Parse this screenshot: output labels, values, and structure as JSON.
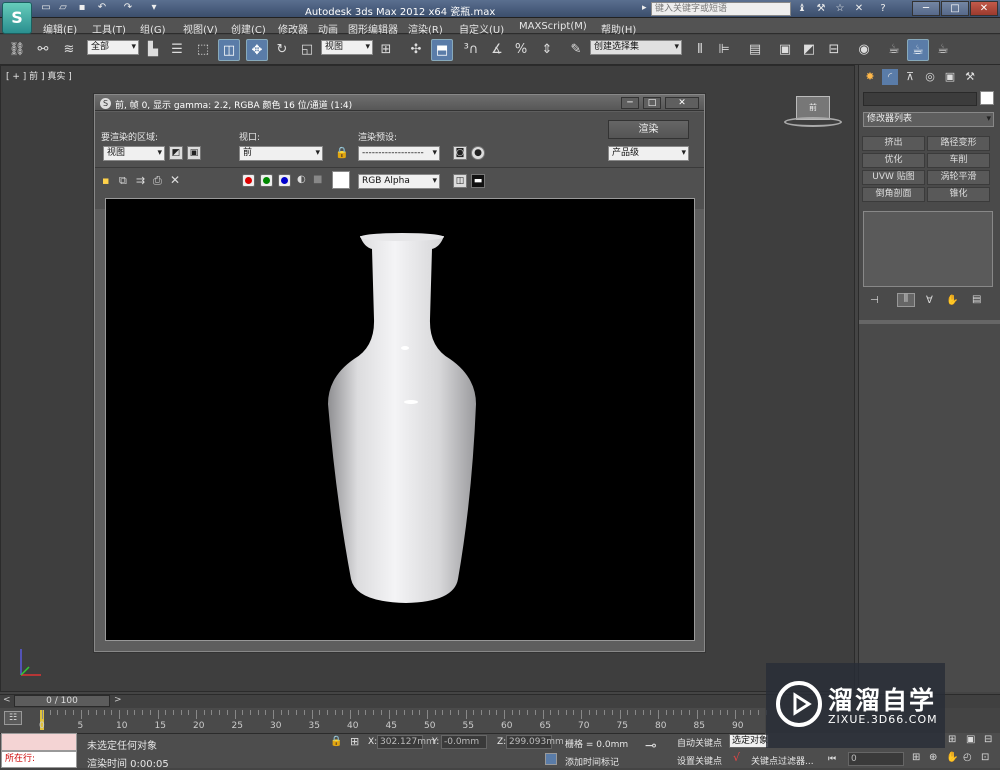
{
  "titlebar": {
    "logo": "S",
    "title": "Autodesk 3ds Max  2012 x64      瓷瓶.max",
    "search_placeholder": "键入关键字或短语",
    "min": "─",
    "max": "□",
    "close": "✕"
  },
  "menu": [
    "编辑(E)",
    "工具(T)",
    "组(G)",
    "视图(V)",
    "创建(C)",
    "修改器",
    "动画",
    "图形编辑器",
    "渲染(R)",
    "自定义(U)",
    "MAXScript(M)",
    "帮助(H)"
  ],
  "toolbar": {
    "selection_filter": "全部",
    "ref_coord": "视图",
    "named_selection": "创建选择集"
  },
  "viewport": {
    "label": "[ + ] 前 ] 真实 ]"
  },
  "render_frame": {
    "title": "前, 帧 0, 显示 gamma: 2.2, RGBA 颜色 16 位/通道 (1:4)",
    "area_label": "要渲染的区域:",
    "area_value": "视图",
    "viewport_label": "视口:",
    "viewport_value": "前",
    "preset_label": "渲染预设:",
    "preset_value": "-------------------",
    "render_button": "渲染",
    "quality_value": "产品级",
    "channel_value": "RGB Alpha"
  },
  "command_panel": {
    "modifier_list": "修改器列表",
    "buttons": [
      "挤出",
      "路径变形",
      "优化",
      "车削",
      "UVW 贴图",
      "涡轮平滑",
      "倒角剖面",
      "锥化"
    ]
  },
  "timeline": {
    "frame": "0 / 100",
    "ticks": [
      "0",
      "5",
      "10",
      "15",
      "20",
      "25",
      "30",
      "35",
      "40",
      "45",
      "50",
      "55",
      "60",
      "65",
      "70",
      "75",
      "80",
      "85",
      "90"
    ]
  },
  "status": {
    "running": "所在行:",
    "message": "未选定任何对象",
    "render_time": "渲染时间  0:00:05",
    "x_label": "X:",
    "x_value": "302.127mm",
    "y_label": "Y:",
    "y_value": "-0.0mm",
    "z_label": "Z:",
    "z_value": "299.093mm",
    "grid": "栅格 = 0.0mm",
    "add_time_tag": "添加时间标记",
    "auto_key": "自动关键点",
    "selected_object": "选定对象",
    "set_key": "设置关键点",
    "key_filter": "关键点过滤器...",
    "frame_value": "0"
  },
  "watermark": {
    "title": "溜溜自学",
    "subtitle": "ZIXUE.3D66.COM"
  }
}
